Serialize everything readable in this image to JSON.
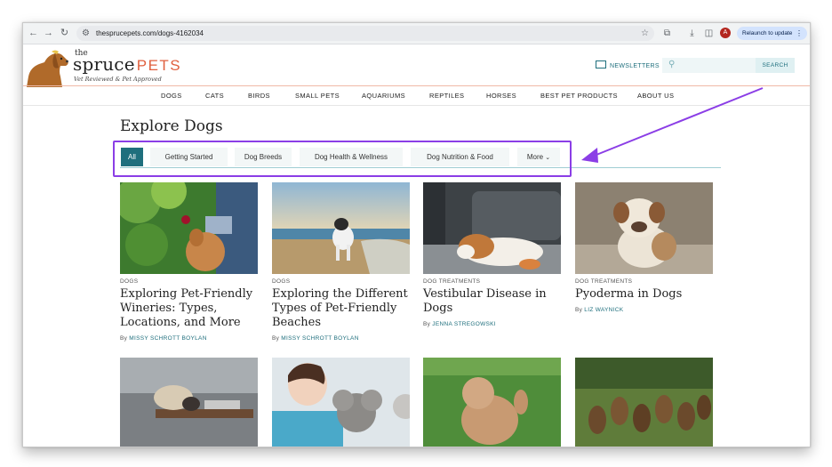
{
  "browser": {
    "url": "thesprucepets.com/dogs-4162034",
    "relaunch_label": "Relaunch to update",
    "profile_initial": "A"
  },
  "site": {
    "logo_the": "the",
    "logo_spruce": "spruce",
    "logo_pets": "PETS",
    "tagline": "Vet Reviewed & Pet Approved",
    "newsletters": "NEWSLETTERS",
    "search_placeholder": "",
    "search_button": "SEARCH",
    "nav": [
      "DOGS",
      "CATS",
      "BIRDS",
      "SMALL PETS",
      "AQUARIUMS",
      "REPTILES",
      "HORSES",
      "BEST PET PRODUCTS",
      "ABOUT US"
    ]
  },
  "page": {
    "title": "Explore Dogs",
    "tabs": [
      {
        "label": "All",
        "active": true
      },
      {
        "label": "Getting Started",
        "active": false
      },
      {
        "label": "Dog Breeds",
        "active": false
      },
      {
        "label": "Dog Health & Wellness",
        "active": false
      },
      {
        "label": "Dog Nutrition & Food",
        "active": false
      },
      {
        "label": "More",
        "active": false
      }
    ],
    "annotation_color": "#8b3ee6",
    "cards": [
      {
        "tag": "DOGS",
        "title": "Exploring Pet-Friendly Wineries: Types, Locations, and More",
        "by": "By",
        "author": "MISSY SCHROTT BOYLAN"
      },
      {
        "tag": "DOGS",
        "title": "Exploring the Different Types of Pet-Friendly Beaches",
        "by": "By",
        "author": "MISSY SCHROTT BOYLAN"
      },
      {
        "tag": "DOG TREATMENTS",
        "title": "Vestibular Disease in Dogs",
        "by": "By",
        "author": "JENNA STREGOWSKI"
      },
      {
        "tag": "DOG TREATMENTS",
        "title": "Pyoderma in Dogs",
        "by": "By",
        "author": "LIZ WAYNICK"
      }
    ]
  },
  "colors": {
    "accent": "#1f6f7d",
    "brand_orange": "#e0603f",
    "highlight": "#8b3ee6"
  }
}
